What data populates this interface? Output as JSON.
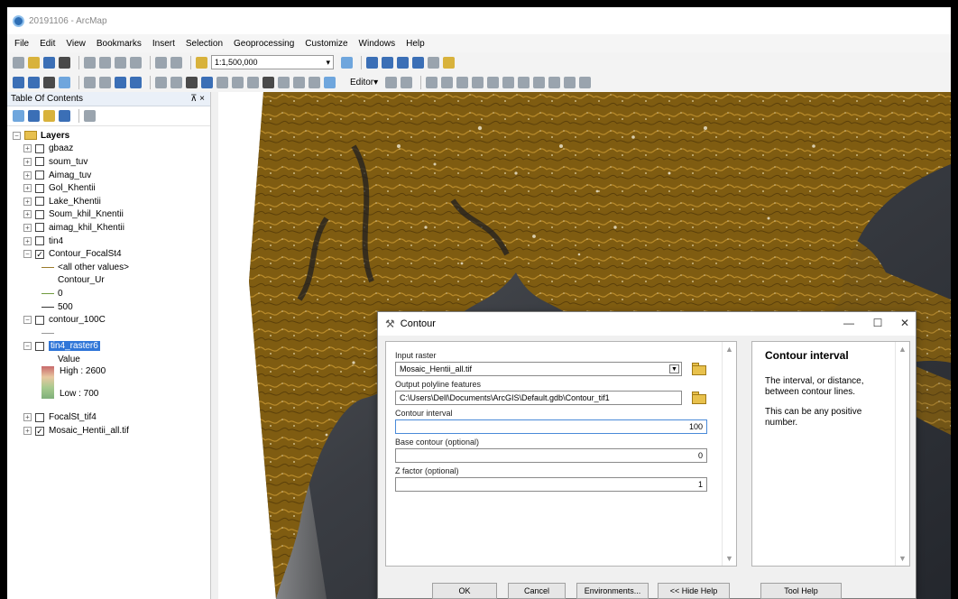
{
  "window": {
    "title": "20191106 - ArcMap"
  },
  "menu": [
    "File",
    "Edit",
    "View",
    "Bookmarks",
    "Insert",
    "Selection",
    "Geoprocessing",
    "Customize",
    "Windows",
    "Help"
  ],
  "toolbar": {
    "scale": "1:1,500,000",
    "editor_label": "Editor▾"
  },
  "toc": {
    "title": "Table Of Contents",
    "pin": "⊼ ×",
    "root": "Layers",
    "layers": [
      {
        "name": "gbaaz",
        "checked": false
      },
      {
        "name": "soum_tuv",
        "checked": false
      },
      {
        "name": "Aimag_tuv",
        "checked": false
      },
      {
        "name": "Gol_Khentii",
        "checked": false
      },
      {
        "name": "Lake_Khentii",
        "checked": false
      },
      {
        "name": "Soum_khil_Knentii",
        "checked": false
      },
      {
        "name": "aimag_khil_Khentii",
        "checked": false
      },
      {
        "name": "tin4",
        "checked": false
      }
    ],
    "contour_layer": {
      "name": "Contour_FocalSt4",
      "checked": true,
      "all_other": "<all other values>",
      "field": "Contour_Ur",
      "v0": "0",
      "v500": "500"
    },
    "contour100": {
      "name": "contour_100C",
      "checked": false
    },
    "raster": {
      "name": "tin4_raster6",
      "checked": false,
      "value_label": "Value",
      "high": "High : 2600",
      "low": "Low : 700"
    },
    "focal": {
      "name": "FocalSt_tif4",
      "checked": false
    },
    "mosaic": {
      "name": "Mosaic_Hentii_all.tif",
      "checked": true
    }
  },
  "dialog": {
    "title": "Contour",
    "input_raster_label": "Input raster",
    "input_raster_value": "Mosaic_Hentii_all.tif",
    "output_label": "Output polyline features",
    "output_value": "C:\\Users\\Dell\\Documents\\ArcGIS\\Default.gdb\\Contour_tif1",
    "interval_label": "Contour interval",
    "interval_value": "100",
    "base_label": "Base contour (optional)",
    "base_value": "0",
    "zfactor_label": "Z factor (optional)",
    "zfactor_value": "1",
    "help_title": "Contour interval",
    "help_p1": "The interval, or distance, between contour lines.",
    "help_p2": "This can be any positive number.",
    "buttons": {
      "ok": "OK",
      "cancel": "Cancel",
      "environments": "Environments...",
      "hide_help": "<< Hide Help",
      "tool_help": "Tool Help"
    }
  },
  "colors": {
    "contour": "#8a6414",
    "selection": "#3076d8",
    "dem_dark": "#2b2f36"
  }
}
